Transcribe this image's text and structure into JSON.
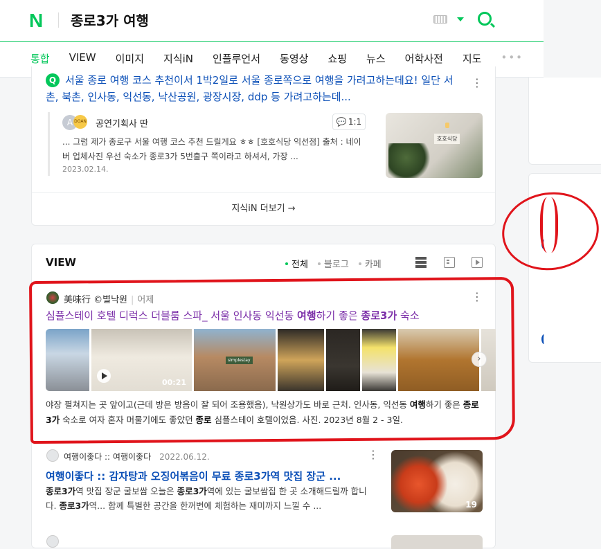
{
  "header": {
    "logo": "N",
    "query": "종로3가 여행",
    "tabs": [
      "통합",
      "VIEW",
      "이미지",
      "지식iN",
      "인플루언서",
      "동영상",
      "쇼핑",
      "뉴스",
      "어학사전",
      "지도"
    ],
    "more": "•••",
    "colors": {
      "brand": "#03c75a",
      "link": "#0b4fb7",
      "visited": "#7b2fa8",
      "annotation": "#e0141b"
    }
  },
  "kin": {
    "badge": "Q",
    "question": "서울 종로 여행 코스 추천이서 1박2일로 서울 종로쪽으로 여행을 가려고하는데요! 일단 서촌, 북촌, 인사동, 익선동, 낙산공원, 광장시장, ddp 등 가려고하는데...",
    "answer": {
      "avatar_letter": "A",
      "badge_text": "DOAN",
      "name": "공연기획사 딴",
      "count": "1:1",
      "text": "... 그럼 제가 종로구 서울 여행 코스 추천 드릴게요 ㅎㅎ [호호식당 익선점] 출처 : 네이버 업체사진 우선 숙소가 종로3가 5번출구 쪽이라고 하셔서, 가장 ...",
      "date": "2023.02.14.",
      "thumb_sign": "호호식당"
    },
    "more_label": "지식iN 더보기 →"
  },
  "view": {
    "title": "VIEW",
    "filters": [
      "전체",
      "블로그",
      "카페"
    ],
    "post1": {
      "author": "美味行 ©별낙원",
      "time": "어제",
      "title_parts": [
        "심플스테이 호텔 디럭스 더블룸 스파_ 서울 인사동 익선동 ",
        "여행",
        "하기 좋은 ",
        "종로3가",
        " 숙소"
      ],
      "video_duration": "00:21",
      "hotel_sign": "simplestay",
      "desc_parts": [
        "야장 펼쳐지는 곳 앞이고(근데 방은 방음이 잘 되어 조용했음), 낙원상가도 바로 근처. 인사동, 익선동 ",
        "여행",
        "하기 좋은 ",
        "종로3가",
        " 숙소로 여자 혼자 머물기에도 좋았던 ",
        "종로",
        " 심플스테이 호텔이었음. 사진. 2023년 8월 2 - 3일."
      ]
    },
    "post2": {
      "author": "여행이좋다 :: 여행이좋다",
      "date": "2022.06.12.",
      "title": "여행이좋다 :: 감자탕과 오징어볶음이 무료 종로3가역 맛집 장군 ...",
      "text_parts": [
        "종로3가",
        "역 맛집 장군 굴보쌈 오늘은 ",
        "종로3가",
        "역에 있는 굴보쌈집 한 곳 소개해드릴까 합니다. ",
        "종로3가",
        "역... 함께 특별한 공간을 한꺼번에 체험하는 재미까지 느낄 수 ..."
      ],
      "thumb_count": "19"
    }
  }
}
